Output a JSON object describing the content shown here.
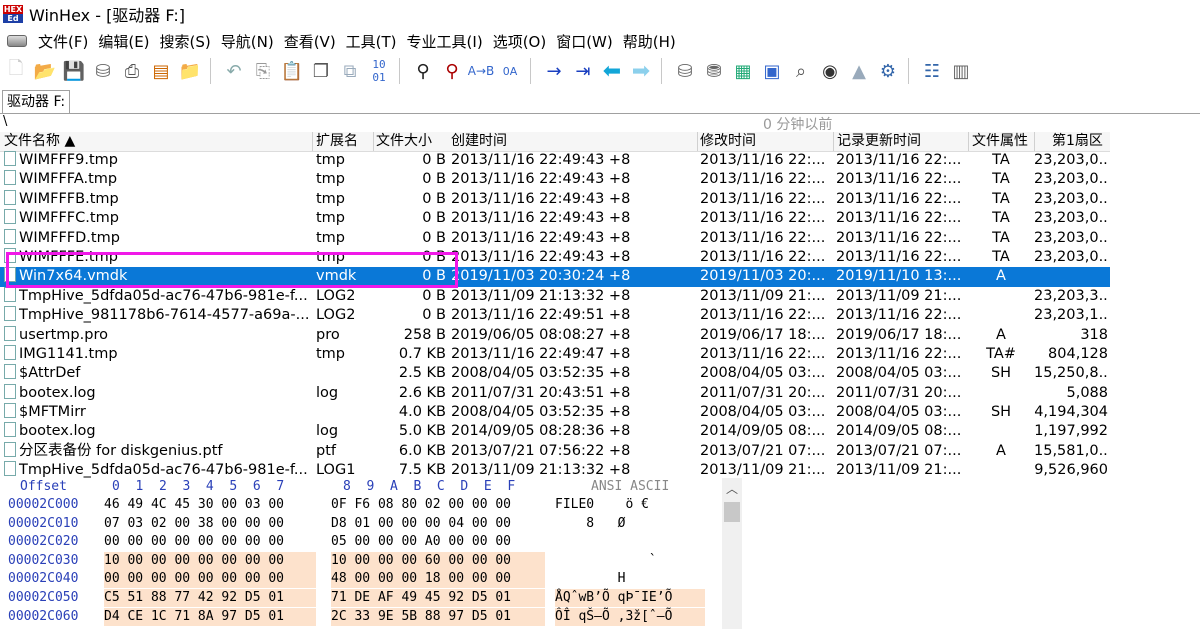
{
  "window": {
    "title": "WinHex - [驱动器 F:]",
    "logo_top": "HEX",
    "logo_bottom": "Ed"
  },
  "menu": [
    "文件(F)",
    "编辑(E)",
    "搜索(S)",
    "导航(N)",
    "查看(V)",
    "工具(T)",
    "专业工具(I)",
    "选项(O)",
    "窗口(W)",
    "帮助(H)"
  ],
  "toolbar_icons": [
    "new-file",
    "open-folder",
    "save",
    "drive",
    "print",
    "properties",
    "open-folder-2",
    "undo",
    "copy",
    "paste",
    "paste-special",
    "copy-block",
    "hex-convert",
    "find",
    "find-hex",
    "replace-text",
    "replace-hex",
    "goto-offset",
    "goto-sector",
    "back",
    "forward",
    "open-disk",
    "clone-disk",
    "ram",
    "calculator",
    "search-magnifier",
    "camera",
    "image",
    "settings",
    "table-view",
    "panel-view"
  ],
  "tab": {
    "label": "驱动器 F:"
  },
  "path": {
    "current": "\\",
    "snapshot_time": "0 分钟以前"
  },
  "columns": {
    "name": "文件名称 ▲",
    "ext": "扩展名",
    "size": "文件大小",
    "created": "创建时间",
    "modified": "修改时间",
    "updated": "记录更新时间",
    "attr": "文件属性",
    "sector": "第1扇区"
  },
  "files": [
    {
      "name": "WIMFFF9.tmp",
      "ext": "tmp",
      "size": "0 B",
      "created": "2013/11/16  22:49:43  +8",
      "modified": "2013/11/16  22:...",
      "updated": "2013/11/16  22:...",
      "attr": "TA",
      "sector": "23,203,0..."
    },
    {
      "name": "WIMFFFA.tmp",
      "ext": "tmp",
      "size": "0 B",
      "created": "2013/11/16  22:49:43  +8",
      "modified": "2013/11/16  22:...",
      "updated": "2013/11/16  22:...",
      "attr": "TA",
      "sector": "23,203,0..."
    },
    {
      "name": "WIMFFFB.tmp",
      "ext": "tmp",
      "size": "0 B",
      "created": "2013/11/16  22:49:43  +8",
      "modified": "2013/11/16  22:...",
      "updated": "2013/11/16  22:...",
      "attr": "TA",
      "sector": "23,203,0..."
    },
    {
      "name": "WIMFFFC.tmp",
      "ext": "tmp",
      "size": "0 B",
      "created": "2013/11/16  22:49:43  +8",
      "modified": "2013/11/16  22:...",
      "updated": "2013/11/16  22:...",
      "attr": "TA",
      "sector": "23,203,0..."
    },
    {
      "name": "WIMFFFD.tmp",
      "ext": "tmp",
      "size": "0 B",
      "created": "2013/11/16  22:49:43  +8",
      "modified": "2013/11/16  22:...",
      "updated": "2013/11/16  22:...",
      "attr": "TA",
      "sector": "23,203,0..."
    },
    {
      "name": "WIMFFFE.tmp",
      "ext": "tmp",
      "size": "0 B",
      "created": "2013/11/16  22:49:43  +8",
      "modified": "2013/11/16  22:...",
      "updated": "2013/11/16  22:...",
      "attr": "TA",
      "sector": "23,203,0..."
    },
    {
      "name": "Win7x64.vmdk",
      "ext": "vmdk",
      "size": "0 B",
      "created": "2019/11/03  20:30:24  +8",
      "modified": "2019/11/03  20:...",
      "updated": "2019/11/10  13:...",
      "attr": "A",
      "sector": ""
    },
    {
      "name": "TmpHive_5dfda05d-ac76-47b6-981e-f...",
      "ext": "LOG2",
      "size": "0 B",
      "created": "2013/11/09  21:13:32  +8",
      "modified": "2013/11/09  21:...",
      "updated": "2013/11/09  21:...",
      "attr": "",
      "sector": "23,203,3..."
    },
    {
      "name": "TmpHive_981178b6-7614-4577-a69a-...",
      "ext": "LOG2",
      "size": "0 B",
      "created": "2013/11/16  22:49:51  +8",
      "modified": "2013/11/16  22:...",
      "updated": "2013/11/16  22:...",
      "attr": "",
      "sector": "23,203,1..."
    },
    {
      "name": "usertmp.pro",
      "ext": "pro",
      "size": "258 B",
      "created": "2019/06/05  08:08:27  +8",
      "modified": "2019/06/17  18:...",
      "updated": "2019/06/17  18:...",
      "attr": "A",
      "sector": "318"
    },
    {
      "name": "IMG1141.tmp",
      "ext": "tmp",
      "size": "0.7 KB",
      "created": "2013/11/16  22:49:47  +8",
      "modified": "2013/11/16  22:...",
      "updated": "2013/11/16  22:...",
      "attr": "TA#",
      "sector": "804,128"
    },
    {
      "name": "$AttrDef",
      "ext": "",
      "size": "2.5 KB",
      "created": "2008/04/05  03:52:35  +8",
      "modified": "2008/04/05  03:...",
      "updated": "2008/04/05  03:...",
      "attr": "SH",
      "sector": "15,250,8..."
    },
    {
      "name": "bootex.log",
      "ext": "log",
      "size": "2.6 KB",
      "created": "2011/07/31  20:43:51  +8",
      "modified": "2011/07/31  20:...",
      "updated": "2011/07/31  20:...",
      "attr": "",
      "sector": "5,088"
    },
    {
      "name": "$MFTMirr",
      "ext": "",
      "size": "4.0 KB",
      "created": "2008/04/05  03:52:35  +8",
      "modified": "2008/04/05  03:...",
      "updated": "2008/04/05  03:...",
      "attr": "SH",
      "sector": "4,194,304"
    },
    {
      "name": "bootex.log",
      "ext": "log",
      "size": "5.0 KB",
      "created": "2014/09/05  08:28:36  +8",
      "modified": "2014/09/05  08:...",
      "updated": "2014/09/05  08:...",
      "attr": "",
      "sector": "1,197,992"
    },
    {
      "name": "分区表备份 for diskgenius.ptf",
      "ext": "ptf",
      "size": "6.0 KB",
      "created": "2013/07/21  07:56:22  +8",
      "modified": "2013/07/21  07:...",
      "updated": "2013/07/21  07:...",
      "attr": "A",
      "sector": "15,581,0..."
    },
    {
      "name": "TmpHive_5dfda05d-ac76-47b6-981e-f...",
      "ext": "LOG1",
      "size": "7.5 KB",
      "created": "2013/11/09  21:13:32  +8",
      "modified": "2013/11/09  21:...",
      "updated": "2013/11/09  21:...",
      "attr": "",
      "sector": "9,526,960"
    }
  ],
  "selected_index": 6,
  "hex": {
    "offset_label": "Offset",
    "col_header_1": "0  1  2  3  4  5  6  7",
    "col_header_2": "8  9  A  B  C  D  E  F",
    "ascii_mode": "ANSI ASCII",
    "rows": [
      {
        "offset": "00002C000",
        "b1": "46 49 4C 45 30 00 03 00",
        "b2": "0F F6 08 80 02 00 00 00",
        "ascii": "FILE0    ö €"
      },
      {
        "offset": "00002C010",
        "b1": "07 03 02 00 38 00 00 00",
        "b2": "D8 01 00 00 00 04 00 00",
        "ascii": "    8   Ø"
      },
      {
        "offset": "00002C020",
        "b1": "00 00 00 00 00 00 00 00",
        "b2": "05 00 00 00 A0 00 00 00",
        "ascii": ""
      },
      {
        "offset": "00002C030",
        "b1": "10 00 00 00 00 00 00 00",
        "b2": "10 00 00 00 60 00 00 00",
        "ascii": "            `"
      },
      {
        "offset": "00002C040",
        "b1": "00 00 00 00 00 00 00 00",
        "b2": "48 00 00 00 18 00 00 00",
        "ascii": "        H"
      },
      {
        "offset": "00002C050",
        "b1": "C5 51 88 77 42 92 D5 01",
        "b2": "71 DE AF 49 45 92 D5 01",
        "ascii": "ÅQˆwB’Õ qÞ¯IE’Õ"
      },
      {
        "offset": "00002C060",
        "b1": "D4 CE 1C 71 8A 97 D5 01",
        "b2": "2C 33 9E 5B 88 97 D5 01",
        "ascii": "ÔÎ qŠ—Õ ,3ž[ˆ—Õ"
      }
    ]
  }
}
